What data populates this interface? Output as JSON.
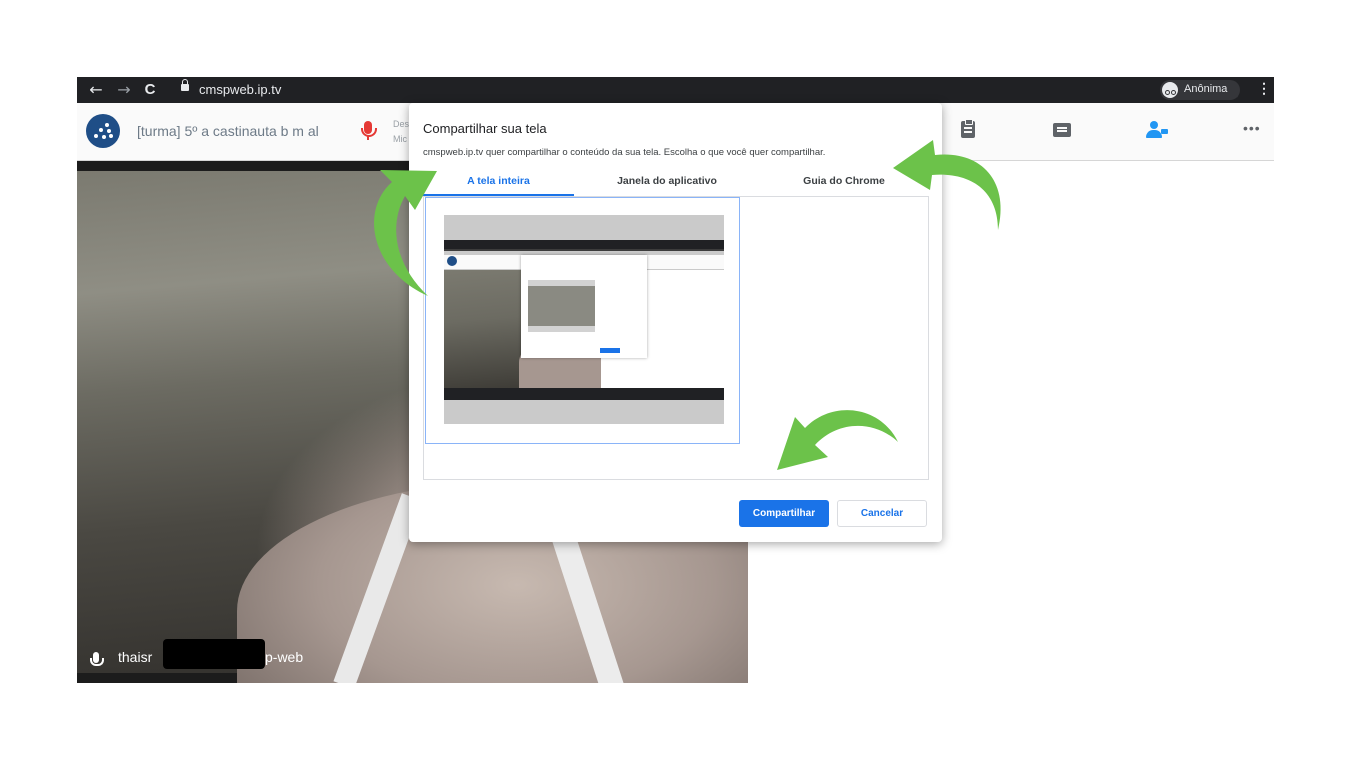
{
  "browser": {
    "url": "cmspweb.ip.tv",
    "profile_label": "Anônima",
    "back_glyph": "←",
    "forward_glyph": "→",
    "reload_glyph": "C",
    "star_glyph": "☆",
    "menu_glyph": "⋮"
  },
  "app": {
    "room_title": "[turma] 5º a castinauta b m al",
    "mic_sub_line1": "Des",
    "mic_sub_line2": "Mic",
    "more_glyph": "•••",
    "icons": [
      "logo-icon",
      "microphone-icon",
      "clipboard-icon",
      "chat-icon",
      "people-icon",
      "more-icon"
    ],
    "accent_color": "#2196f3",
    "mic_color": "#e53935"
  },
  "video": {
    "name_part1": "thaisr",
    "name_part2": "p-web"
  },
  "dialog": {
    "title": "Compartilhar sua tela",
    "description": "cmspweb.ip.tv quer compartilhar o conteúdo da sua tela. Escolha o que você quer compartilhar.",
    "tabs": [
      {
        "label": "A tela inteira",
        "selected": true
      },
      {
        "label": "Janela do aplicativo",
        "selected": false
      },
      {
        "label": "Guia do Chrome",
        "selected": false
      }
    ],
    "share_label": "Compartilhar",
    "cancel_label": "Cancelar",
    "primary_color": "#1a73e8"
  },
  "annotations": {
    "arrow_color": "#6cc24a"
  }
}
